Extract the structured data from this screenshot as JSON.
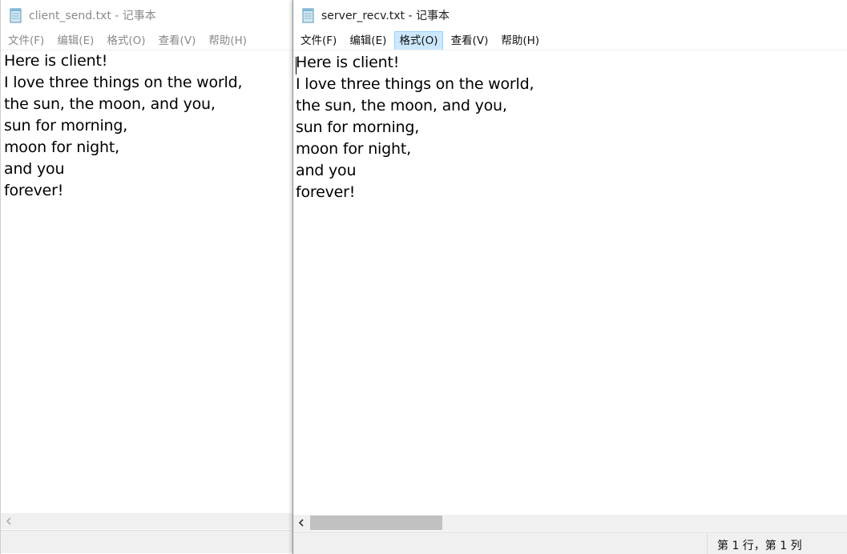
{
  "left_window": {
    "title": "client_send.txt - 记事本",
    "menu": [
      "文件(F)",
      "编辑(E)",
      "格式(O)",
      "查看(V)",
      "帮助(H)"
    ],
    "lines": [
      "Here is client!",
      "I love three things on the world,",
      "the sun, the moon, and you,",
      "sun for morning,",
      "moon for night,",
      "and you",
      "forever!"
    ]
  },
  "right_window": {
    "title": "server_recv.txt - 记事本",
    "menu": [
      "文件(F)",
      "编辑(E)",
      "格式(O)",
      "查看(V)",
      "帮助(H)"
    ],
    "hovered_menu_index": 2,
    "lines": [
      "Here is client!",
      "I love three things on the world,",
      "the sun, the moon, and you,",
      "sun for morning,",
      "moon for night,",
      "and you",
      "forever!"
    ],
    "status_position": "第 1 行，第 1 列"
  },
  "icons": {
    "app": "notepad-icon",
    "scroll_left": "chevron-left-icon"
  },
  "colors": {
    "menu_hover_bg": "#cce8ff",
    "menu_hover_border": "#99d1ff",
    "statusbar_bg": "#f0f0f0",
    "scroll_thumb": "#c1c1c1"
  }
}
